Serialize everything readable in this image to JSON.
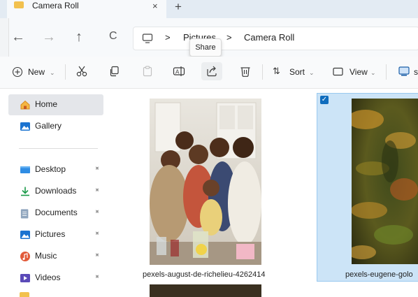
{
  "window": {
    "tab_title": "Camera Roll",
    "tab_close": "×",
    "new_tab": "+"
  },
  "nav": {
    "back": "←",
    "forward": "→",
    "up": "↑",
    "refresh": "C"
  },
  "breadcrumb": {
    "separator": ">",
    "items": [
      "Pictures",
      "Camera Roll"
    ]
  },
  "tooltip": "Share",
  "toolbar": {
    "new_label": "New",
    "sort_label": "Sort",
    "view_label": "View"
  },
  "sidebar": {
    "items": [
      {
        "label": "Home",
        "icon": "home-icon",
        "color": "#e8a33b"
      },
      {
        "label": "Gallery",
        "icon": "gallery-icon",
        "color": "#1b73d0"
      },
      {
        "label": "Desktop",
        "icon": "desktop-icon",
        "color": "#2f8de4"
      },
      {
        "label": "Downloads",
        "icon": "download-icon",
        "color": "#1a9a48"
      },
      {
        "label": "Documents",
        "icon": "documents-icon",
        "color": "#7a8fa6"
      },
      {
        "label": "Pictures",
        "icon": "pictures-icon",
        "color": "#1b73d0"
      },
      {
        "label": "Music",
        "icon": "music-icon",
        "color": "#e25b3a"
      },
      {
        "label": "Videos",
        "icon": "videos-icon",
        "color": "#5b4ab8"
      }
    ]
  },
  "files": [
    {
      "name": "pexels-august-de-richelieu-4262414",
      "selected": false
    },
    {
      "name": "pexels-eugene-golo",
      "selected": true
    }
  ],
  "colors": {
    "accent": "#0f6cbd",
    "selection": "#cce4f7"
  }
}
